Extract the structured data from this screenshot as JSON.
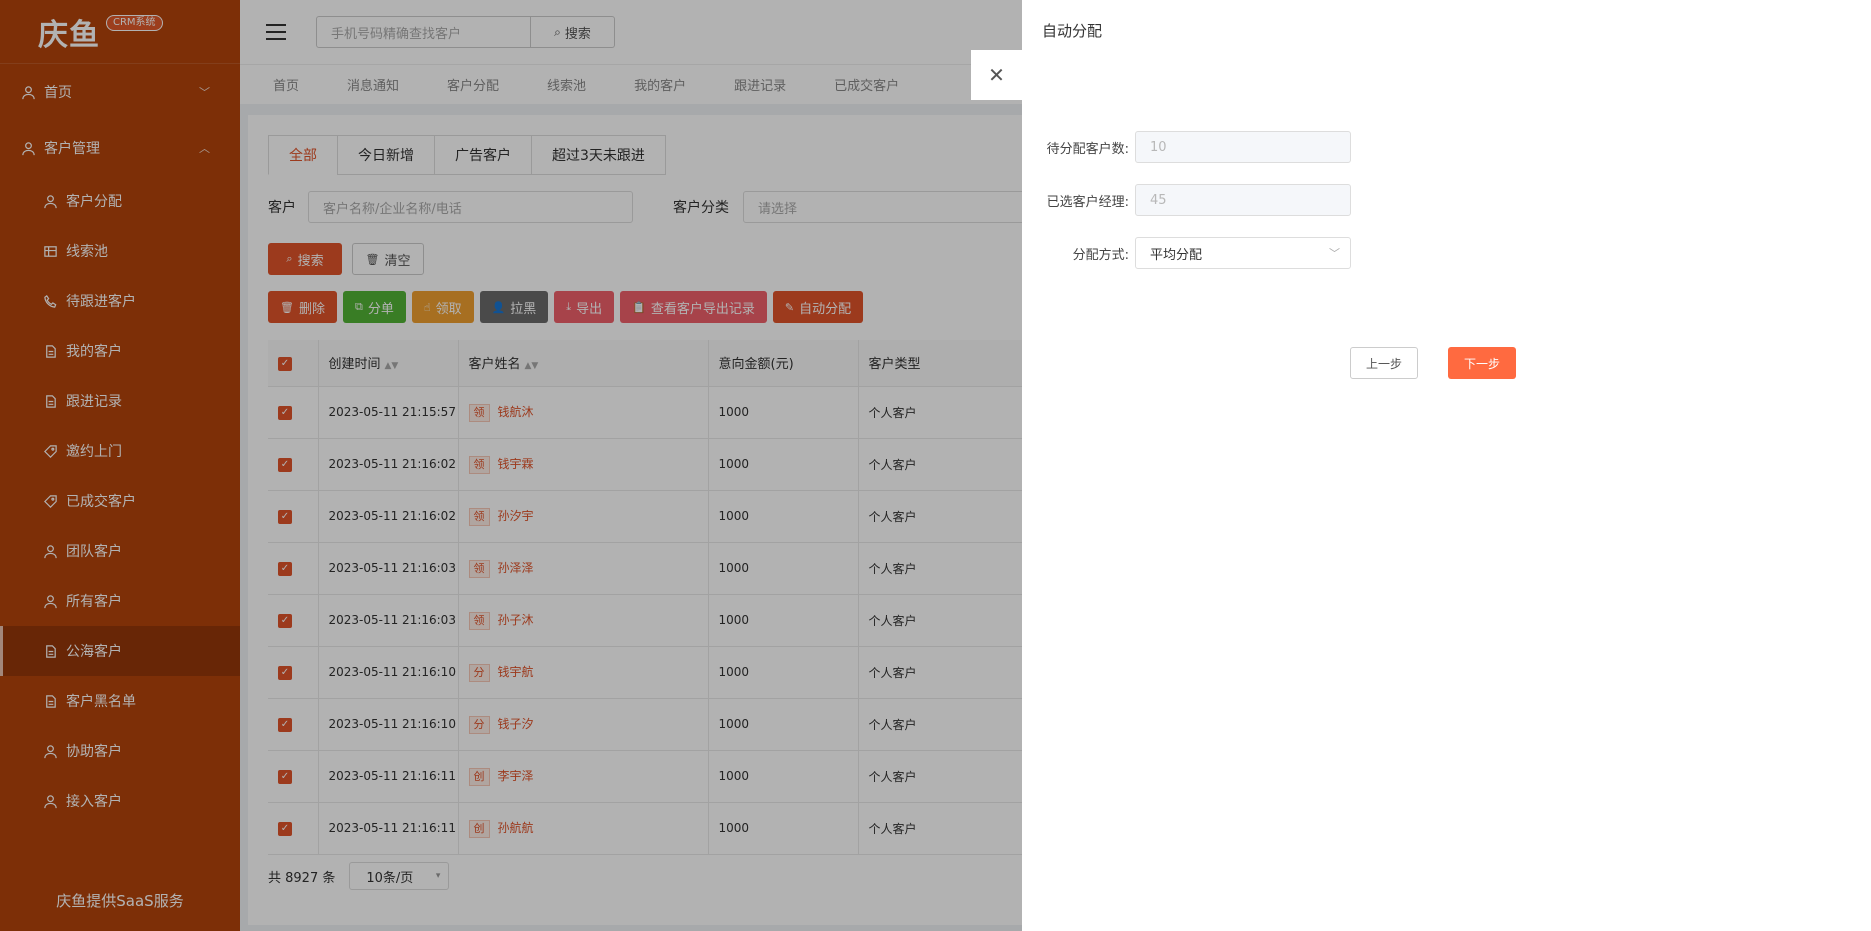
{
  "brand": {
    "logo_text": "庆鱼",
    "badge": "CRM系统",
    "footer": "庆鱼提供SaaS服务"
  },
  "sidebar": {
    "groups": [
      {
        "label": "首页",
        "chevron": "chevron-down"
      },
      {
        "label": "客户管理",
        "chevron": "chevron-up"
      }
    ],
    "items": [
      {
        "label": "客户分配",
        "icon": "user-icon"
      },
      {
        "label": "线索池",
        "icon": "table-icon"
      },
      {
        "label": "待跟进客户",
        "icon": "phone-icon"
      },
      {
        "label": "我的客户",
        "icon": "document-icon"
      },
      {
        "label": "跟进记录",
        "icon": "document-icon"
      },
      {
        "label": "邀约上门",
        "icon": "tag-icon"
      },
      {
        "label": "已成交客户",
        "icon": "tag-icon"
      },
      {
        "label": "团队客户",
        "icon": "user-icon"
      },
      {
        "label": "所有客户",
        "icon": "user-icon"
      },
      {
        "label": "公海客户",
        "icon": "document-icon",
        "active": true
      },
      {
        "label": "客户黑名单",
        "icon": "document-icon"
      },
      {
        "label": "协助客户",
        "icon": "user-icon"
      },
      {
        "label": "接入客户",
        "icon": "user-icon"
      }
    ]
  },
  "header": {
    "search_placeholder": "手机号码精确查找客户",
    "search_button": "搜索",
    "nav_tabs": [
      "首页",
      "消息通知",
      "客户分配",
      "线索池",
      "我的客户",
      "跟进记录",
      "已成交客户"
    ]
  },
  "filters": {
    "tabs": [
      "全部",
      "今日新增",
      "广告客户",
      "超过3天未跟进"
    ],
    "customer_label": "客户",
    "customer_placeholder": "客户名称/企业名称/电话",
    "category_label": "客户分类",
    "category_placeholder": "请选择",
    "search_button": "搜索",
    "clear_button": "清空"
  },
  "actions": [
    {
      "label": "删除",
      "color": "#e0532a",
      "icon": "trash-icon"
    },
    {
      "label": "分单",
      "color": "#52b435",
      "icon": "copy-icon"
    },
    {
      "label": "领取",
      "color": "#f0a030",
      "icon": "hand-icon"
    },
    {
      "label": "拉黑",
      "color": "#6b6b6b",
      "icon": "user-block-icon"
    },
    {
      "label": "导出",
      "color": "#f0606a",
      "icon": "download-icon"
    },
    {
      "label": "查看客户导出记录",
      "color": "#f0606a",
      "icon": "clipboard-icon"
    },
    {
      "label": "自动分配",
      "color": "#e0532a",
      "icon": "edit-icon"
    }
  ],
  "table": {
    "columns": [
      "创建时间",
      "客户姓名",
      "意向金额(元)",
      "客户类型"
    ],
    "rows": [
      {
        "time": "2023-05-11 21:15:57",
        "tag": "领",
        "name": "钱航沐",
        "amount": "1000",
        "type": "个人客户"
      },
      {
        "time": "2023-05-11 21:16:02",
        "tag": "领",
        "name": "钱宇霖",
        "amount": "1000",
        "type": "个人客户"
      },
      {
        "time": "2023-05-11 21:16:02",
        "tag": "领",
        "name": "孙汐宇",
        "amount": "1000",
        "type": "个人客户"
      },
      {
        "time": "2023-05-11 21:16:03",
        "tag": "领",
        "name": "孙泽泽",
        "amount": "1000",
        "type": "个人客户"
      },
      {
        "time": "2023-05-11 21:16:03",
        "tag": "领",
        "name": "孙子沐",
        "amount": "1000",
        "type": "个人客户"
      },
      {
        "time": "2023-05-11 21:16:10",
        "tag": "分",
        "name": "钱宇航",
        "amount": "1000",
        "type": "个人客户"
      },
      {
        "time": "2023-05-11 21:16:10",
        "tag": "分",
        "name": "钱子汐",
        "amount": "1000",
        "type": "个人客户"
      },
      {
        "time": "2023-05-11 21:16:11",
        "tag": "创",
        "name": "李宇泽",
        "amount": "1000",
        "type": "个人客户"
      },
      {
        "time": "2023-05-11 21:16:11",
        "tag": "创",
        "name": "孙航航",
        "amount": "1000",
        "type": "个人客户"
      }
    ]
  },
  "pagination": {
    "total": "共 8927 条",
    "page_size": "10条/页"
  },
  "drawer": {
    "title": "自动分配",
    "fields": [
      {
        "label": "待分配客户数:",
        "value": "10",
        "kind": "disabled"
      },
      {
        "label": "已选客户经理:",
        "value": "45",
        "kind": "disabled"
      },
      {
        "label": "分配方式:",
        "value": "平均分配",
        "kind": "select"
      }
    ],
    "prev_button": "上一步",
    "next_button": "下一步",
    "accent": "#ff6a40"
  }
}
